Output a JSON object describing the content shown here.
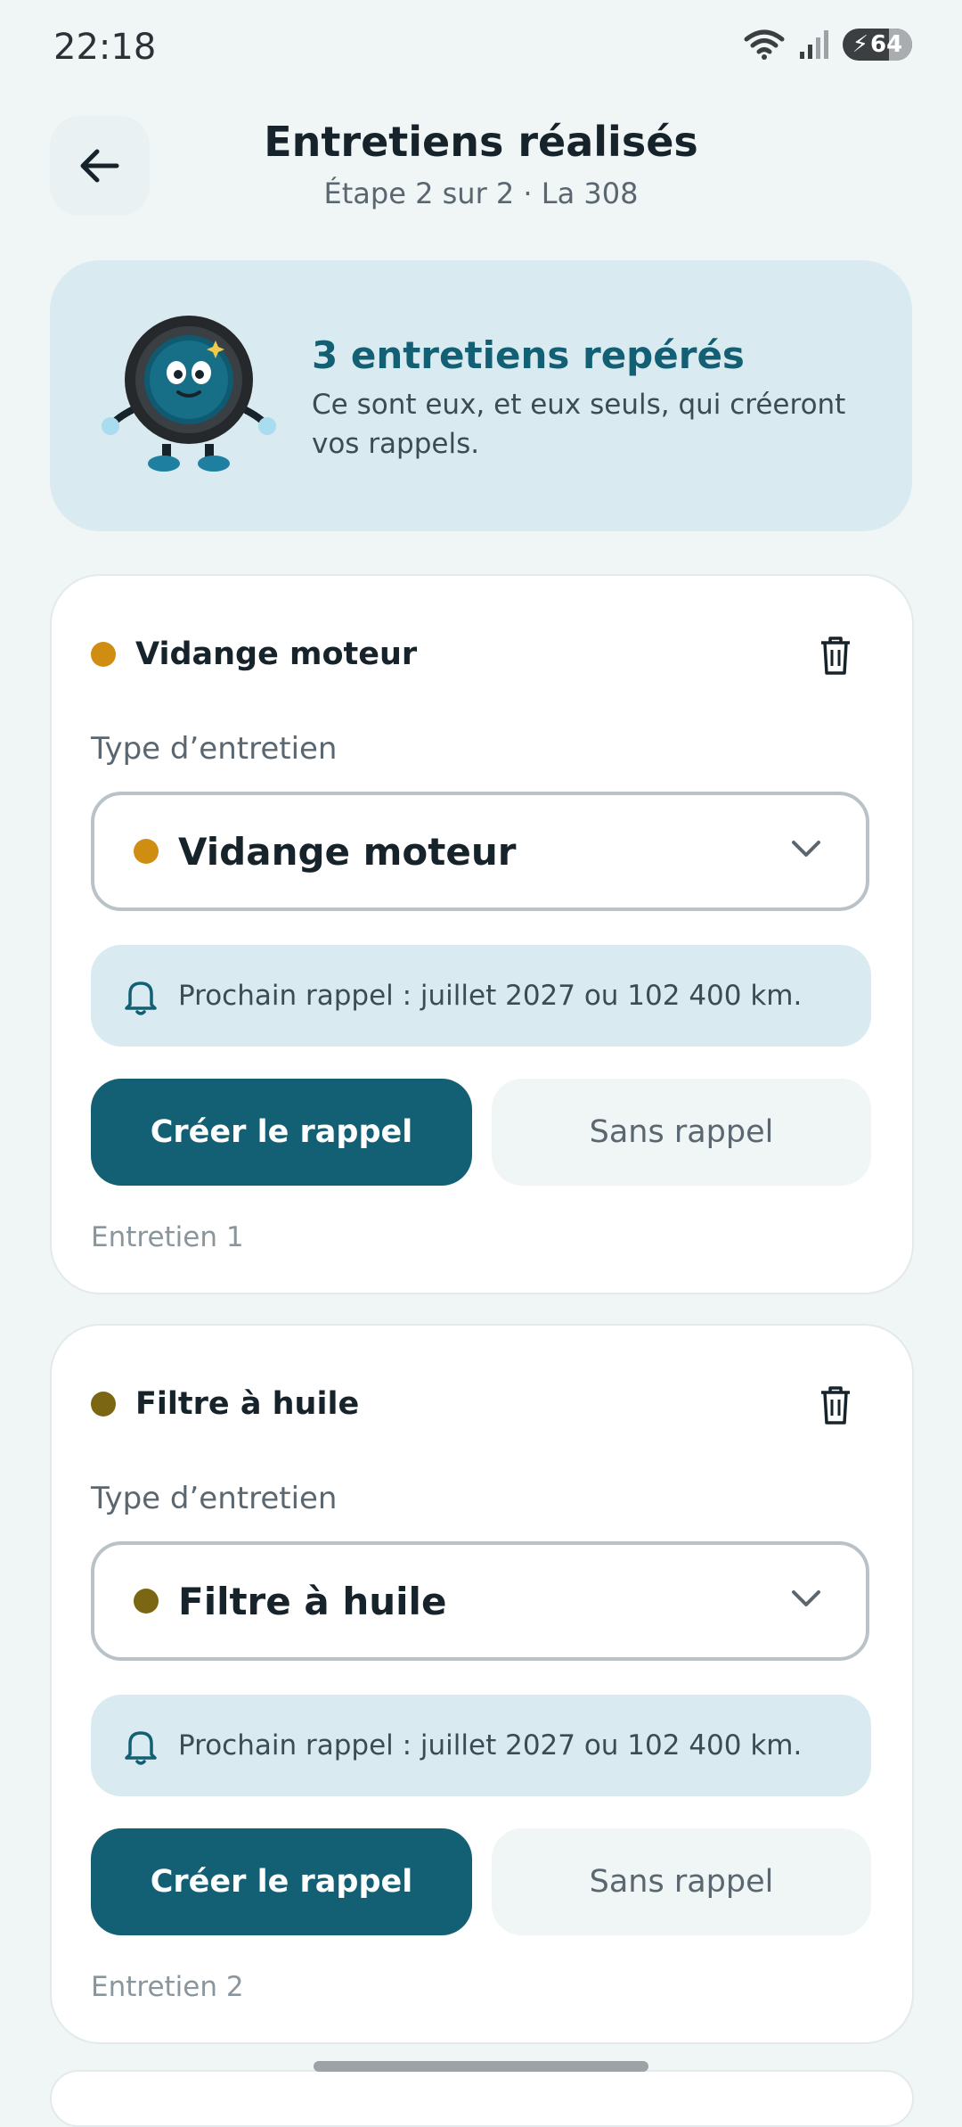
{
  "status": {
    "time": "22:18",
    "battery": "64"
  },
  "header": {
    "title": "Entretiens réalisés",
    "subtitle": "Étape 2 sur 2 · La 308"
  },
  "hero": {
    "title": "3 entretiens repérés",
    "text": "Ce sont eux, et eux seuls, qui créeront vos rappels."
  },
  "cards": [
    {
      "name": "Vidange moteur",
      "dot_color": "#cf8d12",
      "type_label": "Type d’entretien",
      "selected_type": "Vidange moteur",
      "reminder": "Prochain rappel : juillet 2027 ou 102 400 km.",
      "create_label": "Créer le rappel",
      "skip_label": "Sans rappel",
      "footer": "Entretien 1"
    },
    {
      "name": "Filtre à huile",
      "dot_color": "#7a6613",
      "type_label": "Type d’entretien",
      "selected_type": "Filtre à huile",
      "reminder": "Prochain rappel : juillet 2027 ou 102 400 km.",
      "create_label": "Créer le rappel",
      "skip_label": "Sans rappel",
      "footer": "Entretien 2"
    }
  ],
  "colors": {
    "accent": "#135f73",
    "info_bg": "#d9ebf1",
    "background": "#f0f5f6"
  },
  "icons": [
    "back-arrow-icon",
    "wifi-icon",
    "signal-icon",
    "battery-icon",
    "trash-icon",
    "chevron-down-icon",
    "bell-icon"
  ]
}
